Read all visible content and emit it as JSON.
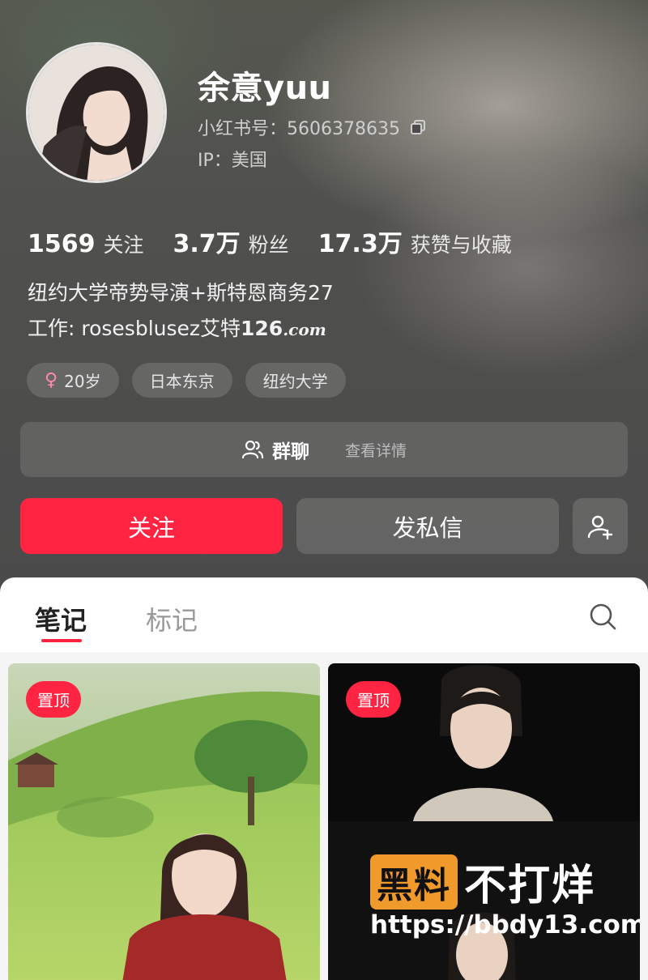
{
  "profile": {
    "name": "余意yuu",
    "redid_label": "小红书号：5606378635",
    "ip_label": "IP：美国"
  },
  "stats": [
    {
      "value": "1569",
      "label": "关注"
    },
    {
      "value": "3.7万",
      "label": "粉丝"
    },
    {
      "value": "17.3万",
      "label": "获赞与收藏"
    }
  ],
  "bio": {
    "line1": "纽约大学帝势导演+斯特恩商务27",
    "line2_prefix": "工作: rosesblusez艾特",
    "line2_num": "126",
    "line2_domain": ".com"
  },
  "tags": [
    {
      "icon": "female-icon",
      "symbol": "♀",
      "label": "20岁"
    },
    {
      "label": "日本东京"
    },
    {
      "label": "纽约大学"
    }
  ],
  "group": {
    "label": "群聊",
    "detail": "查看详情"
  },
  "actions": {
    "follow": "关注",
    "message": "发私信"
  },
  "tabs": [
    {
      "label": "笔记",
      "active": true
    },
    {
      "label": "标记",
      "active": false
    }
  ],
  "notes": [
    {
      "pin": "置顶"
    },
    {
      "pin": "置顶",
      "watermark_badge": "黑料",
      "watermark_text": "不打烊",
      "watermark_url": "https://bbdy13.com"
    }
  ],
  "colors": {
    "accent": "#ff2442",
    "watermark_badge": "#f09a2b"
  }
}
